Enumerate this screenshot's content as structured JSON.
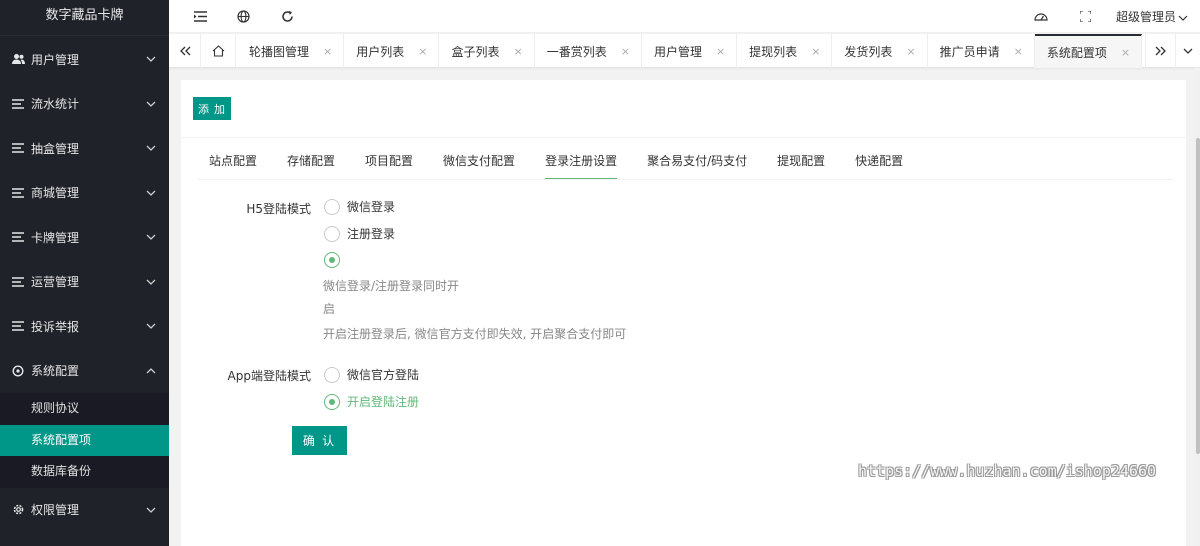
{
  "app": {
    "brand": "数字藏品卡牌"
  },
  "sidebar": {
    "items": [
      {
        "label": "用户管理",
        "icon": "users-icon"
      },
      {
        "label": "流水统计",
        "icon": "list-icon"
      },
      {
        "label": "抽盒管理",
        "icon": "list-icon"
      },
      {
        "label": "商城管理",
        "icon": "list-icon"
      },
      {
        "label": "卡牌管理",
        "icon": "list-icon"
      },
      {
        "label": "运营管理",
        "icon": "list-icon"
      },
      {
        "label": "投诉举报",
        "icon": "list-icon"
      },
      {
        "label": "系统配置",
        "icon": "settings-circle-icon",
        "open": true
      },
      {
        "label": "权限管理",
        "icon": "gear-icon"
      }
    ],
    "submenu": [
      {
        "label": "规则协议"
      },
      {
        "label": "系统配置项",
        "active": true
      },
      {
        "label": "数据库备份"
      }
    ]
  },
  "header": {
    "user_label": "超级管理员"
  },
  "tabs": [
    {
      "label": "轮播图管理"
    },
    {
      "label": "用户列表"
    },
    {
      "label": "盒子列表"
    },
    {
      "label": "一番赏列表"
    },
    {
      "label": "用户管理"
    },
    {
      "label": "提现列表"
    },
    {
      "label": "发货列表"
    },
    {
      "label": "推广员申请"
    },
    {
      "label": "系统配置项",
      "active": true
    }
  ],
  "tab_close_glyph": "×",
  "content": {
    "add_label": "添 加",
    "subtabs": [
      {
        "label": "站点配置"
      },
      {
        "label": "存储配置"
      },
      {
        "label": "项目配置"
      },
      {
        "label": "微信支付配置"
      },
      {
        "label": "登录注册设置",
        "active": true
      },
      {
        "label": "聚合易支付/码支付"
      },
      {
        "label": "提现配置"
      },
      {
        "label": "快递配置"
      }
    ],
    "h5": {
      "label": "H5登陆模式",
      "options": [
        "微信登录",
        "注册登录",
        "微信登录/注册登录同时开",
        "启"
      ],
      "selected_index": 2,
      "hint": "开启注册登录后, 微信官方支付即失效, 开启聚合支付即可"
    },
    "app": {
      "label": "App端登陆模式",
      "options": [
        "微信官方登陆",
        "开启登陆注册"
      ],
      "selected_index": 1
    },
    "confirm_label": "确 认"
  },
  "watermark": "https://www.huzhan.com/ishop24660",
  "colors": {
    "accent": "#009688",
    "radio_checked": "#5fb878",
    "sidebar_bg": "#20222a"
  }
}
